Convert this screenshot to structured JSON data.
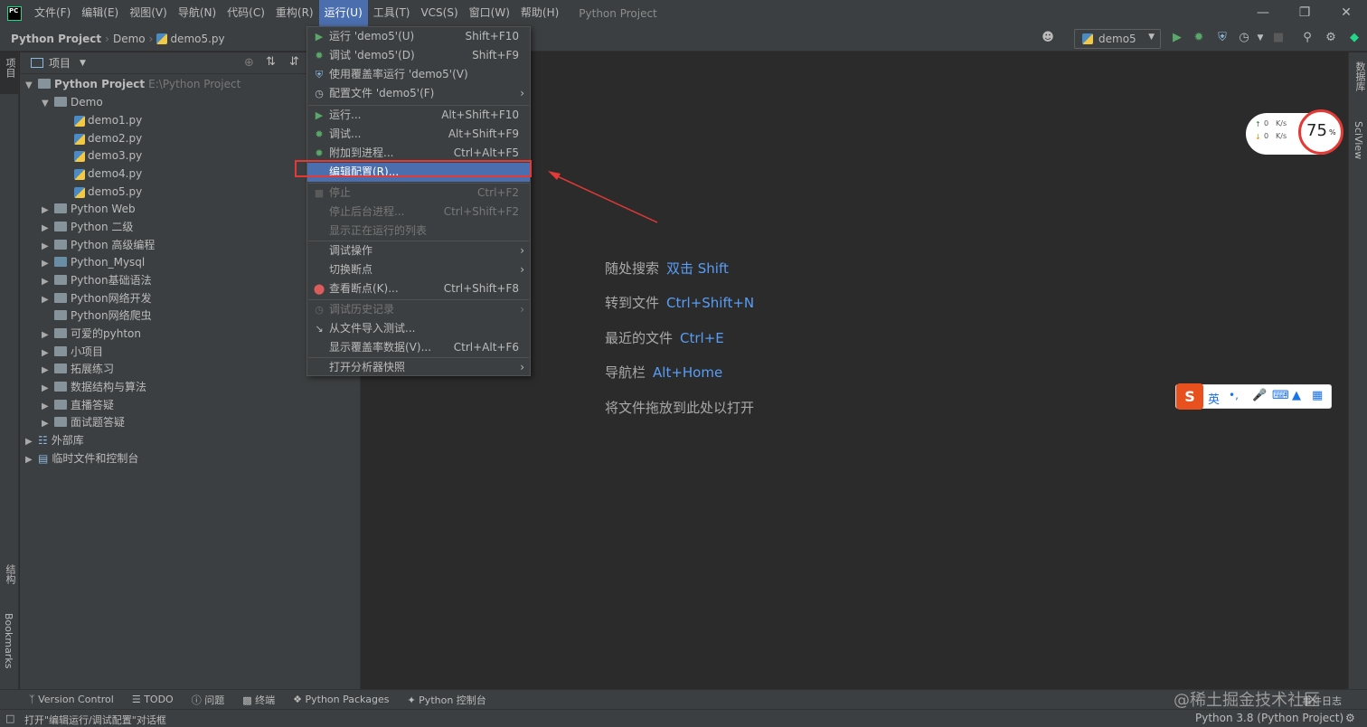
{
  "menubar": {
    "items": [
      "文件(F)",
      "编辑(E)",
      "视图(V)",
      "导航(N)",
      "代码(C)",
      "重构(R)",
      "运行(U)",
      "工具(T)",
      "VCS(S)",
      "窗口(W)",
      "帮助(H)"
    ],
    "title": "Python Project"
  },
  "navbar": {
    "project": "Python Project",
    "folder": "Demo",
    "file": "demo5.py",
    "run_config": "demo5"
  },
  "sidebar_left": {
    "project_label": "项目",
    "structure_label": "结构",
    "bookmarks_label": "Bookmarks"
  },
  "sidebar_right": {
    "database_label": "数据库",
    "sciview_label": "SciView"
  },
  "project_panel": {
    "header": "项目",
    "root_name": "Python Project",
    "root_path": "E:\\Python Project",
    "demo_folder": "Demo",
    "files": [
      "demo1.py",
      "demo2.py",
      "demo3.py",
      "demo4.py",
      "demo5.py"
    ],
    "folders": [
      "Python Web",
      "Python 二级",
      "Python 高级编程",
      "Python_Mysql",
      "Python基础语法",
      "Python网络开发",
      "Python网络爬虫",
      "可爱的pyhton",
      "小项目",
      "拓展练习",
      "数据结构与算法",
      "直播答疑",
      "面试题答疑"
    ],
    "external_libs": "外部库",
    "scratches": "临时文件和控制台"
  },
  "run_menu": {
    "items": [
      {
        "label": "运行 'demo5'(U)",
        "shortcut": "Shift+F10"
      },
      {
        "label": "调试 'demo5'(D)",
        "shortcut": "Shift+F9"
      },
      {
        "label": "使用覆盖率运行 'demo5'(V)",
        "shortcut": ""
      },
      {
        "label": "配置文件 'demo5'(F)",
        "shortcut": ""
      },
      {
        "label": "运行...",
        "shortcut": "Alt+Shift+F10"
      },
      {
        "label": "调试...",
        "shortcut": "Alt+Shift+F9"
      },
      {
        "label": "附加到进程...",
        "shortcut": "Ctrl+Alt+F5"
      },
      {
        "label": "编辑配置(R)...",
        "shortcut": ""
      },
      {
        "label": "停止",
        "shortcut": "Ctrl+F2"
      },
      {
        "label": "停止后台进程...",
        "shortcut": "Ctrl+Shift+F2"
      },
      {
        "label": "显示正在运行的列表",
        "shortcut": ""
      },
      {
        "label": "调试操作",
        "shortcut": ""
      },
      {
        "label": "切换断点",
        "shortcut": ""
      },
      {
        "label": "查看断点(K)...",
        "shortcut": "Ctrl+Shift+F8"
      },
      {
        "label": "调试历史记录",
        "shortcut": ""
      },
      {
        "label": "从文件导入测试...",
        "shortcut": ""
      },
      {
        "label": "显示覆盖率数据(V)...",
        "shortcut": "Ctrl+Alt+F6"
      },
      {
        "label": "打开分析器快照",
        "shortcut": ""
      }
    ]
  },
  "editor_tips": [
    {
      "label": "随处搜索",
      "key": "双击 Shift"
    },
    {
      "label": "转到文件",
      "key": "Ctrl+Shift+N"
    },
    {
      "label": "最近的文件",
      "key": "Ctrl+E"
    },
    {
      "label": "导航栏",
      "key": "Alt+Home"
    },
    {
      "label": "将文件拖放到此处以打开",
      "key": ""
    }
  ],
  "net_widget": {
    "up": "0",
    "down": "0",
    "unit": "K/s",
    "percent": "75",
    "percent_sign": "%"
  },
  "ime_bar": {
    "lang": "英",
    "punct": "•,"
  },
  "toolwindows": {
    "items": [
      "Version Control",
      "TODO",
      "问题",
      "终端",
      "Python Packages",
      "Python 控制台"
    ]
  },
  "statusbar": {
    "message": "打开\"编辑运行/调试配置\"对话框",
    "interpreter": "Python 3.8 (Python Project)",
    "watermark": "@稀土掘金技术社区",
    "event_log": "事件日志"
  },
  "colors": {
    "menu_bg": "#3c3f41",
    "editor_bg": "#2b2b2b",
    "selection": "#4b6eaf",
    "accent_link": "#589df6",
    "highlight_box": "#e53935",
    "run_green": "#59a869"
  }
}
